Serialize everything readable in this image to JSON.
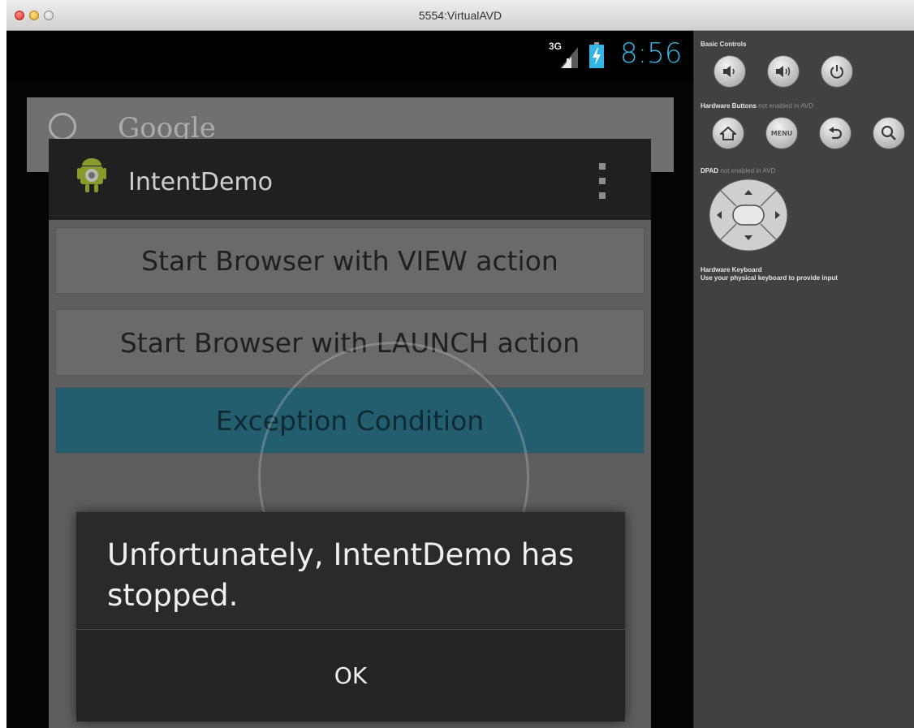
{
  "window": {
    "title": "5554:VirtualAVD"
  },
  "statusbar": {
    "network": "3G",
    "time": "8:56"
  },
  "home": {
    "search_text": "Google"
  },
  "app": {
    "title": "IntentDemo",
    "buttons": [
      {
        "label": "Start Browser with VIEW action"
      },
      {
        "label": "Start Browser with LAUNCH action"
      },
      {
        "label": "Exception Condition"
      }
    ]
  },
  "dialog": {
    "message": "Unfortunately, IntentDemo has stopped.",
    "ok_label": "OK"
  },
  "panel": {
    "basic_controls_label": "Basic Controls",
    "hw_buttons_label": "Hardware Buttons",
    "hw_buttons_note": "not enabled in AVD",
    "dpad_label": "DPAD",
    "dpad_note": "not enabled in AVD",
    "hw_keyboard_label": "Hardware Keyboard",
    "hw_keyboard_note": "Use your physical keyboard to provide input",
    "menu_label": "MENU"
  },
  "colors": {
    "clock": "#33b5e5",
    "highlight_button": "#235e6e"
  }
}
